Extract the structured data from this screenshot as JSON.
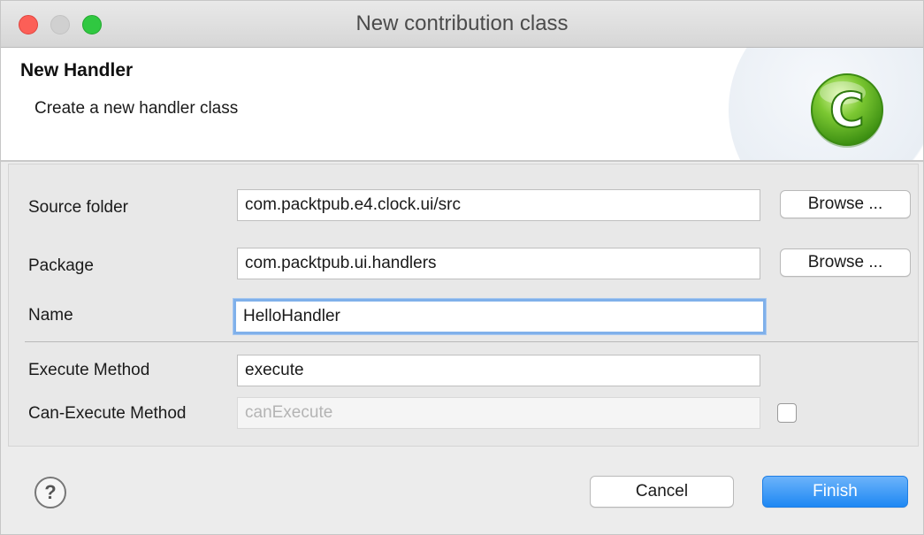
{
  "window": {
    "title": "New contribution class"
  },
  "header": {
    "title": "New Handler",
    "description": "Create a new handler class",
    "icon": "class-c-icon"
  },
  "form": {
    "source_folder": {
      "label": "Source folder",
      "value": "com.packtpub.e4.clock.ui/src",
      "browse_label": "Browse ..."
    },
    "package": {
      "label": "Package",
      "value": "com.packtpub.ui.handlers",
      "browse_label": "Browse ..."
    },
    "name": {
      "label": "Name",
      "value": "HelloHandler"
    },
    "execute_method": {
      "label": "Execute Method",
      "value": "execute"
    },
    "can_execute_method": {
      "label": "Can-Execute Method",
      "placeholder": "canExecute",
      "checked": false
    }
  },
  "footer": {
    "help_glyph": "?",
    "cancel_label": "Cancel",
    "finish_label": "Finish"
  },
  "colors": {
    "accent": "#1e88f3",
    "close": "#fc5f57",
    "maximize": "#30c841",
    "focus_ring": "#7fb0ea"
  }
}
